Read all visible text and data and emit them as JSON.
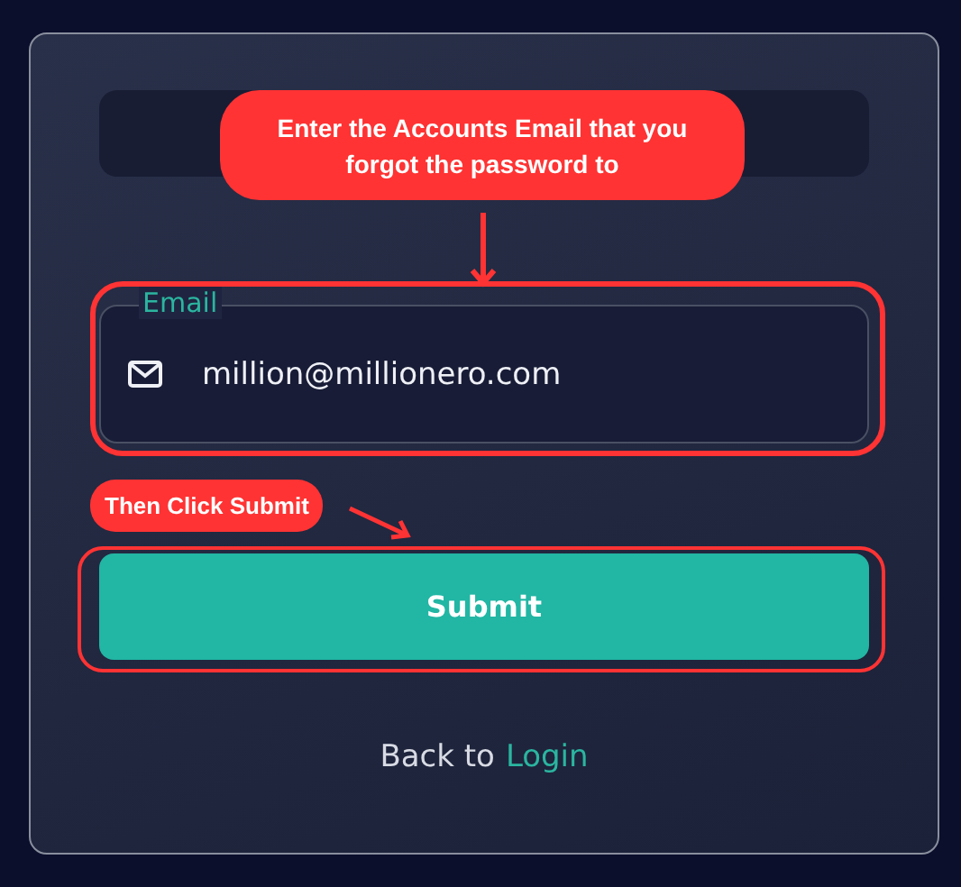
{
  "email_field": {
    "label": "Email",
    "value": "million@millionero.com"
  },
  "submit_button": {
    "label": "Submit"
  },
  "back_link": {
    "prefix": "Back to",
    "link": "Login"
  },
  "annotations": [
    {
      "kind": "callout",
      "text": "Enter the Accounts Email that you forgot the password to"
    },
    {
      "kind": "pill",
      "text": "Then Click Submit"
    }
  ]
}
